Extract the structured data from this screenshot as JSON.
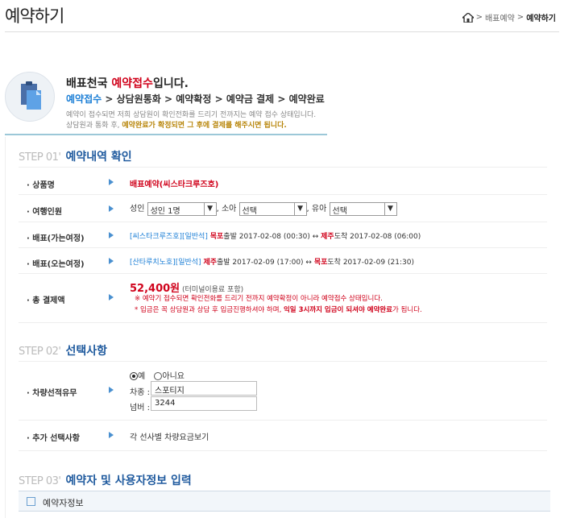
{
  "header": {
    "title": "예약하기",
    "breadcrumb": [
      "배표예약",
      "예약하기"
    ]
  },
  "notice": {
    "title_prefix": "배표천국 ",
    "title_highlight": "예약접수",
    "title_suffix": "입니다.",
    "steps": [
      "예약접수",
      "상담원통화",
      "예약확정",
      "예약금 결제",
      "예약완료"
    ],
    "desc1": "예약이 접수되면 저희 상담원이 확인전화를 드리기 전까지는 예약 접수 상태입니다.",
    "desc2_prefix": "상담원과 통화 후, ",
    "desc2_highlight": "예약완료가 확정되면 그 후에 결제를 해주시면 됩니다."
  },
  "step1": {
    "no": "STEP 01'",
    "title": "예약내역 확인",
    "rows": {
      "product": {
        "label": "· 상품명",
        "value": "배표예약(씨스타크루즈호)"
      },
      "people": {
        "label": "· 여행인원",
        "adult_label": "성인",
        "adult_value": "성인 1명",
        "child_label": ", 소아",
        "child_value": "선택",
        "infant_label": ", 유아",
        "infant_value": "선택"
      },
      "go": {
        "label": "· 배표(가는여정)",
        "ship": "[씨스타크루즈호][일반석]",
        "from": "목포",
        "dep": "출발 2017-02-08 (00:30) ↔",
        "to": "제주",
        "arr": "도착 2017-02-08 (06:00)"
      },
      "back": {
        "label": "· 배표(오는여정)",
        "ship": "[산타루치노호][일반석]",
        "from": "제주",
        "dep": "출발 2017-02-09 (17:00) ↔",
        "to": "목포",
        "arr": "도착 2017-02-09 (21:30)"
      },
      "total": {
        "label": "· 총 결제액",
        "amount": "52,400원",
        "amount_note": " (터미널이용료 포함)",
        "note1": "※ 예약기 접수되면 확인전화를 드리기 전까지 예약확정이 아니라 예약접수 상태입니다.",
        "note2_prefix": "* 입금은 꼭 상담원과 상담 후 입금진행하셔야 하며, ",
        "note2_highlight": "익일 3시까지 입금이 되셔야 예약완료",
        "note2_suffix": "가 됩니다."
      }
    }
  },
  "step2": {
    "no": "STEP 02'",
    "title": "선택사항",
    "car": {
      "label": "· 차량선적유무",
      "yes": "예",
      "no": "아니요",
      "type_label": "차종 :",
      "type_value": "스포티지",
      "number_label": "넘버 :",
      "number_value": "3244"
    },
    "extra": {
      "label": "· 추가 선택사항",
      "value": "각 선사별 차량요금보기"
    }
  },
  "step3": {
    "no": "STEP 03'",
    "title": "예약자 및 사용자정보 입력",
    "subbar": "예약자정보"
  }
}
